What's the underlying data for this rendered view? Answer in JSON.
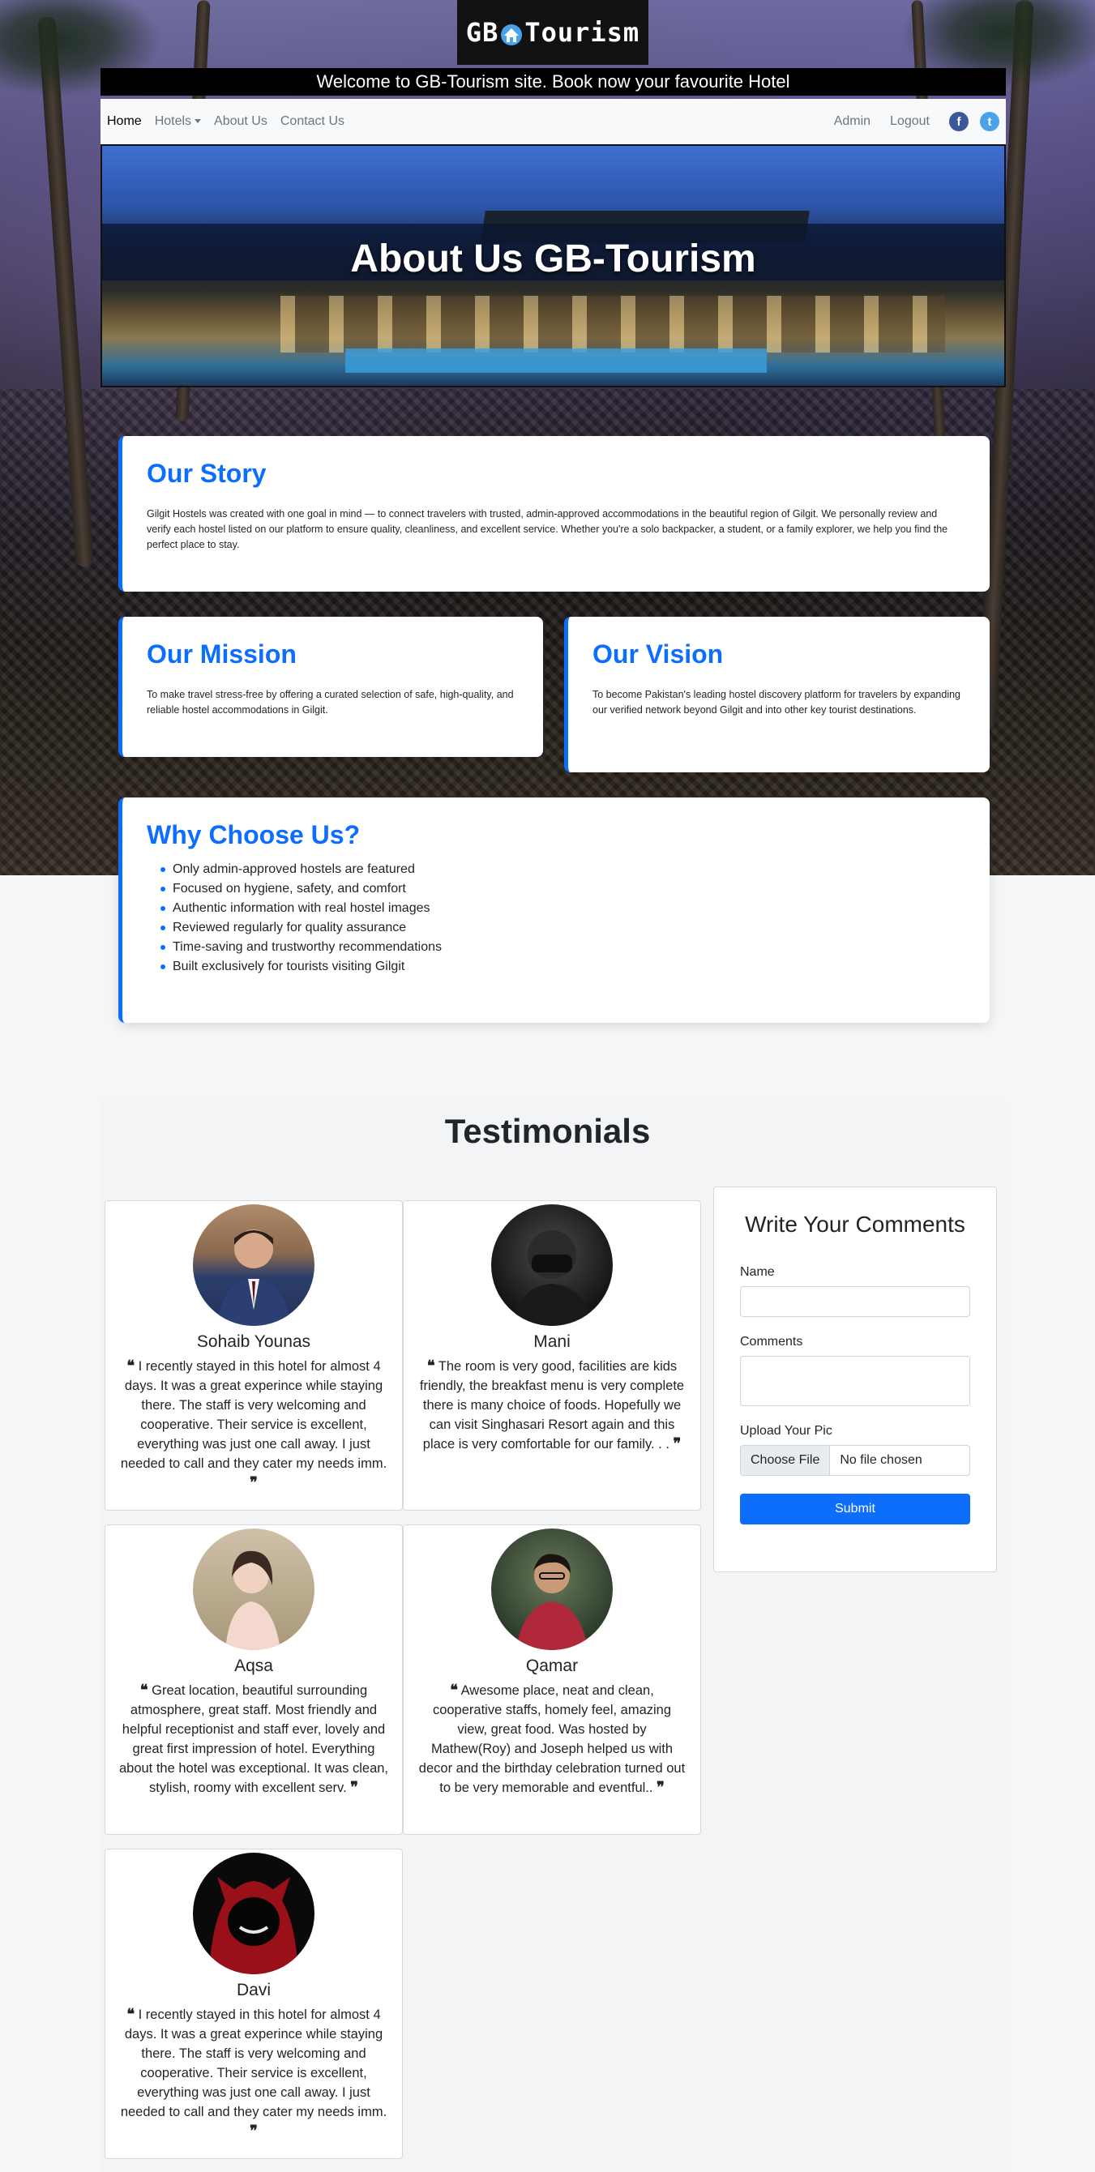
{
  "brand": {
    "logo_left": "GB",
    "logo_right": "Tourism"
  },
  "welcome_text": "Welcome to GB-Tourism site. Book now your favourite Hotel",
  "nav": {
    "home": "Home",
    "hotels": "Hotels",
    "about": "About Us",
    "contact": "Contact Us",
    "admin": "Admin",
    "logout": "Logout",
    "facebook_glyph": "f",
    "twitter_glyph": "t"
  },
  "banner": {
    "title": "About Us GB-Tourism"
  },
  "story": {
    "title": "Our Story",
    "text": "Gilgit Hostels was created with one goal in mind — to connect travelers with trusted, admin-approved accommodations in the beautiful region of Gilgit. We personally review and verify each hostel listed on our platform to ensure quality, cleanliness, and excellent service. Whether you're a solo backpacker, a student, or a family explorer, we help you find the perfect place to stay."
  },
  "mission": {
    "title": "Our Mission",
    "text": "To make travel stress-free by offering a curated selection of safe, high-quality, and reliable hostel accommodations in Gilgit."
  },
  "vision": {
    "title": "Our Vision",
    "text": "To become Pakistan's leading hostel discovery platform for travelers by expanding our verified network beyond Gilgit and into other key tourist destinations."
  },
  "why": {
    "title": "Why Choose Us?",
    "items": [
      "Only admin-approved hostels are featured",
      "Focused on hygiene, safety, and comfort",
      "Authentic information with real hostel images",
      "Reviewed regularly for quality assurance",
      "Time-saving and trustworthy recommendations",
      "Built exclusively for tourists visiting Gilgit"
    ]
  },
  "testimonials": {
    "title": "Testimonials",
    "open_quote": "❝",
    "close_quote": "❞",
    "items": [
      {
        "name": "Sohaib Younas",
        "quote": "I recently stayed in this hotel for almost 4 days. It was a great experince while staying there. The staff is very welcoming and cooperative. Their service is excellent, everything was just one call away. I just needed to call and they cater my needs imm."
      },
      {
        "name": "Mani",
        "quote": "The room is very good, facilities are kids friendly, the breakfast menu is very complete there is many choice of foods. Hopefully we can visit Singhasari Resort again and this place is very comfortable for our family. . ."
      },
      {
        "name": "Aqsa",
        "quote": "Great location, beautiful surrounding atmosphere, great staff. Most friendly and helpful receptionist and staff ever, lovely and great first impression of hotel. Everything about the hotel was exceptional. It was clean, stylish, roomy with excellent serv."
      },
      {
        "name": "Qamar",
        "quote": "Awesome place, neat and clean, cooperative staffs, homely feel, amazing view, great food. Was hosted by Mathew(Roy) and Joseph helped us with decor and the birthday celebration turned out to be very memorable and eventful.."
      },
      {
        "name": "Davi",
        "quote": "I recently stayed in this hotel for almost 4 days. It was a great experince while staying there. The staff is very welcoming and cooperative. Their service is excellent, everything was just one call away. I just needed to call and they cater my needs imm."
      }
    ]
  },
  "comment_form": {
    "title": "Write Your Comments",
    "name_label": "Name",
    "comments_label": "Comments",
    "pic_label": "Upload Your Pic",
    "choose_file": "Choose File",
    "no_file": "No file chosen",
    "submit": "Submit"
  },
  "colors": {
    "accent": "#0d6efd",
    "facebook": "#3b5998",
    "twitter": "#4aa3e8"
  }
}
